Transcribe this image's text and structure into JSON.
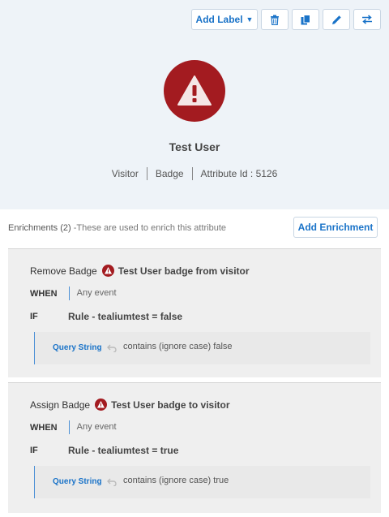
{
  "toolbar": {
    "add_label": "Add Label",
    "icons": [
      "trash-icon",
      "copy-icon",
      "pencil-icon",
      "swap-icon"
    ]
  },
  "attribute": {
    "name": "Test User",
    "meta": [
      "Visitor",
      "Badge",
      "Attribute Id : 5126"
    ],
    "avatar_color": "#a31b20"
  },
  "enrichments": {
    "header": "Enrichments (2)",
    "subtitle": " -These are used to enrich this attribute",
    "add_button": "Add Enrichment",
    "items": [
      {
        "action": "Remove Badge",
        "target": "Test User badge from visitor",
        "when_label": "WHEN",
        "when_value": "Any event",
        "if_label": "IF",
        "rule": "Rule - tealiumtest = false",
        "condition_source": "Query String",
        "condition_text": "contains (ignore case) false"
      },
      {
        "action": "Assign Badge",
        "target": "Test User badge to visitor",
        "when_label": "WHEN",
        "when_value": "Any event",
        "if_label": "IF",
        "rule": "Rule - tealiumtest = true",
        "condition_source": "Query String",
        "condition_text": "contains (ignore case) true"
      }
    ]
  },
  "colors": {
    "accent": "#1a73c8",
    "badge": "#a31b20",
    "panel": "#eef3f8",
    "card": "#efefef"
  }
}
